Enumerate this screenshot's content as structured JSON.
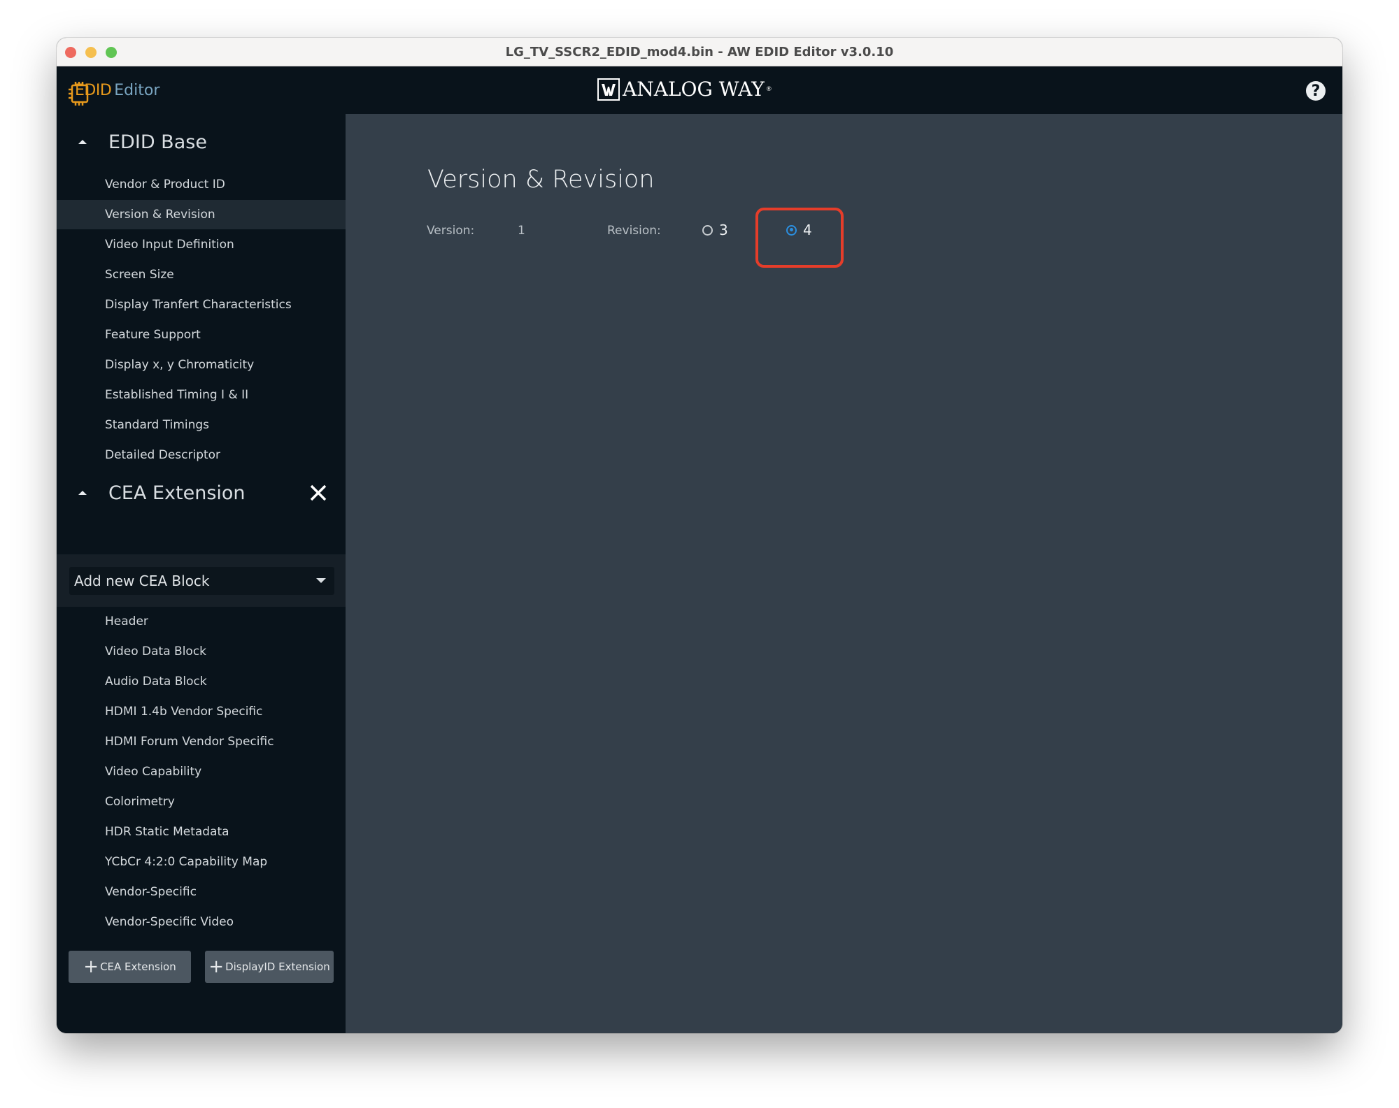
{
  "window": {
    "title": "LG_TV_SSCR2_EDID_mod4.bin - AW EDID Editor v3.0.10"
  },
  "header": {
    "logo_edid": "EDID",
    "logo_editor": "Editor",
    "brand_mark": "AW",
    "brand_name": "ANALOG WAY",
    "brand_reg": "®",
    "help_label": "?"
  },
  "sidebar": {
    "edid_base": {
      "title": "EDID Base",
      "items": [
        {
          "label": "Vendor & Product ID",
          "active": false
        },
        {
          "label": "Version & Revision",
          "active": true
        },
        {
          "label": "Video Input Definition",
          "active": false
        },
        {
          "label": "Screen Size",
          "active": false
        },
        {
          "label": "Display Tranfert Characteristics",
          "active": false
        },
        {
          "label": "Feature Support",
          "active": false
        },
        {
          "label": "Display x, y Chromaticity",
          "active": false
        },
        {
          "label": "Established Timing I & II",
          "active": false
        },
        {
          "label": "Standard Timings",
          "active": false
        },
        {
          "label": "Detailed Descriptor",
          "active": false
        }
      ]
    },
    "cea_extension": {
      "title": "CEA Extension",
      "add_block_select": "Add new CEA Block",
      "items": [
        {
          "label": "Header"
        },
        {
          "label": "Video Data Block"
        },
        {
          "label": "Audio Data Block"
        },
        {
          "label": "HDMI 1.4b Vendor Specific"
        },
        {
          "label": "HDMI Forum Vendor Specific"
        },
        {
          "label": "Video Capability"
        },
        {
          "label": "Colorimetry"
        },
        {
          "label": "HDR Static Metadata"
        },
        {
          "label": "YCbCr 4:2:0 Capability Map"
        },
        {
          "label": "Vendor-Specific"
        },
        {
          "label": "Vendor-Specific Video"
        }
      ]
    },
    "footer": {
      "add_cea_label": "CEA Extension",
      "add_displayid_label": "DisplayID Extension",
      "plus": "+"
    }
  },
  "main": {
    "title": "Version & Revision",
    "version_label": "Version:",
    "version_value": "1",
    "revision_label": "Revision:",
    "revision_options": [
      {
        "label": "3",
        "checked": false
      },
      {
        "label": "4",
        "checked": true
      }
    ]
  },
  "colors": {
    "accent_orange": "#e89a1c",
    "radio_selected": "#2b8fe0",
    "highlight_red": "#e53d2a",
    "main_bg": "#343f4a",
    "sidebar_bg": "#09131b"
  }
}
